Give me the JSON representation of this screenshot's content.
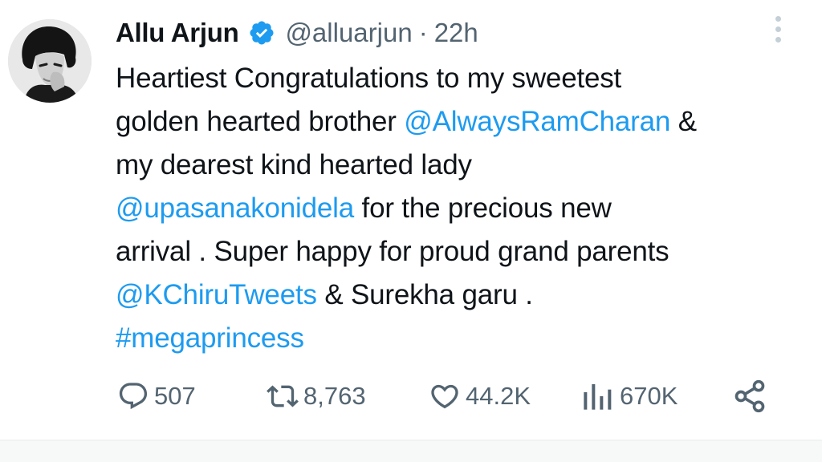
{
  "tweet": {
    "author": {
      "name": "Allu Arjun",
      "handle": "@alluarjun",
      "separator": "·",
      "time": "22h",
      "verified": true
    },
    "text_lines": [
      [
        {
          "t": "Heartiest Congratulations to my sweetest",
          "link": false
        }
      ],
      [
        {
          "t": "golden hearted brother ",
          "link": false
        },
        {
          "t": "@AlwaysRamCharan",
          "link": true
        },
        {
          "t": " &",
          "link": false
        }
      ],
      [
        {
          "t": "my dearest kind hearted lady",
          "link": false
        }
      ],
      [
        {
          "t": "@upasanakonidela",
          "link": true
        },
        {
          "t": " for the precious new",
          "link": false
        }
      ],
      [
        {
          "t": "arrival . Super happy for proud grand parents",
          "link": false
        }
      ],
      [
        {
          "t": "@KChiruTweets",
          "link": true
        },
        {
          "t": " & Surekha garu .",
          "link": false
        }
      ],
      [
        {
          "t": "#megaprincess",
          "link": true
        }
      ]
    ],
    "stats": {
      "replies": "507",
      "retweets": "8,763",
      "likes": "44.2K",
      "views": "670K"
    }
  },
  "icons": {
    "verified": "verified-badge-icon",
    "more": "more-vertical-icon",
    "reply": "reply-icon",
    "retweet": "retweet-icon",
    "like": "heart-icon",
    "views": "views-chart-icon",
    "share": "share-icon"
  },
  "colors": {
    "link": "#1d9bf0",
    "text": "#0f1419",
    "muted": "#536471"
  }
}
